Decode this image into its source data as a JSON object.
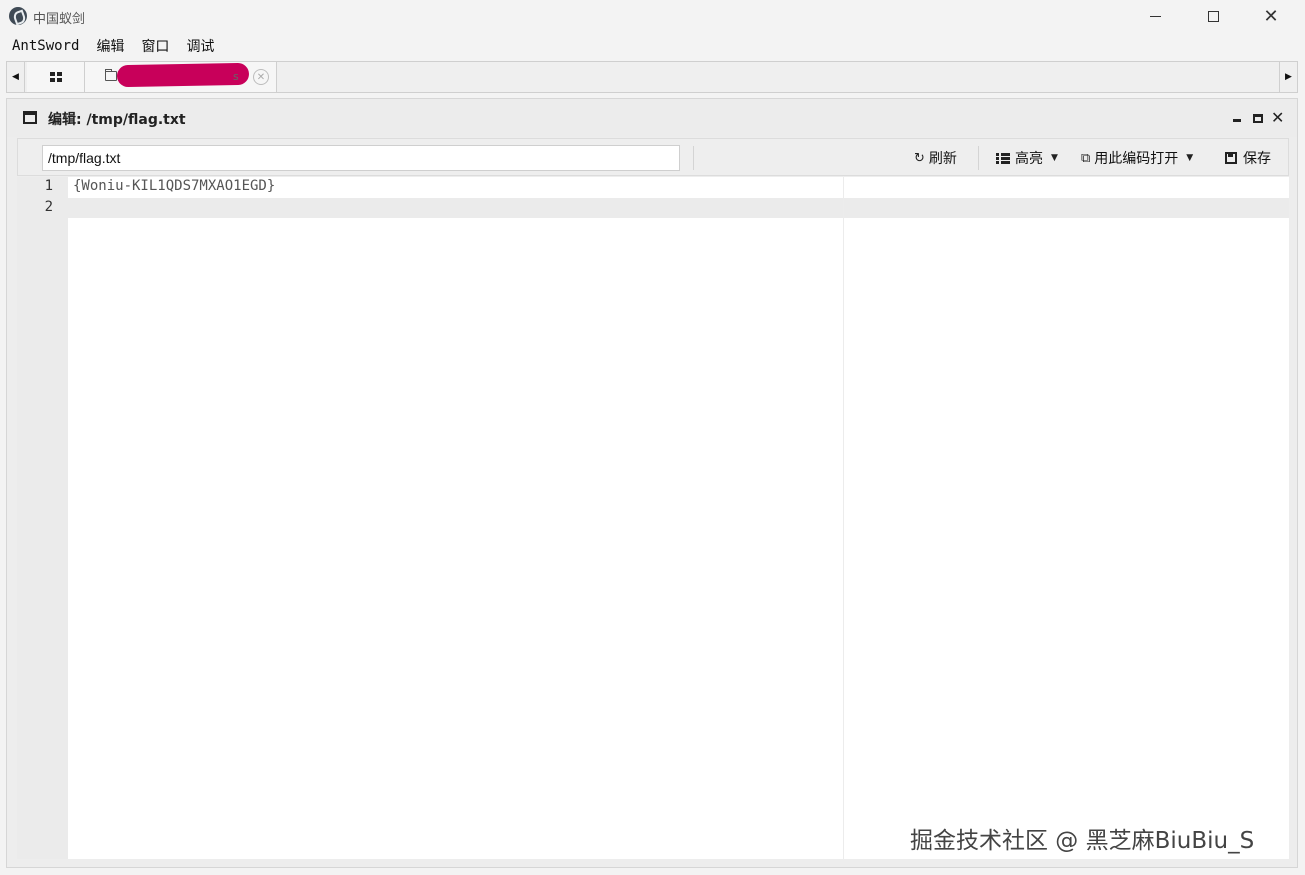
{
  "window": {
    "title": "中国蚁剑",
    "close_glyph": "✕"
  },
  "menu": {
    "items": [
      "AntSword",
      "编辑",
      "窗口",
      "调试"
    ]
  },
  "tabs": {
    "left_arrow": "◀",
    "right_arrow": "▶",
    "file_tab_tail": "s",
    "close_glyph": "✕"
  },
  "panel": {
    "title": "编辑: /tmp/flag.txt",
    "close_glyph": "✕"
  },
  "toolbar": {
    "path_value": "/tmp/flag.txt",
    "refresh_icon": "↻",
    "refresh_label": "刷新",
    "highlight_label": "高亮",
    "encoding_icon": "⧉",
    "encoding_label": "用此编码打开",
    "save_label": "保存",
    "caret": "▼"
  },
  "editor": {
    "line_numbers": [
      "1",
      "2"
    ],
    "lines": [
      "{Woniu-KIL1QDS7MXAO1EGD}",
      ""
    ]
  },
  "watermark": "掘金技术社区 @ 黑芝麻BiuBiu_S"
}
